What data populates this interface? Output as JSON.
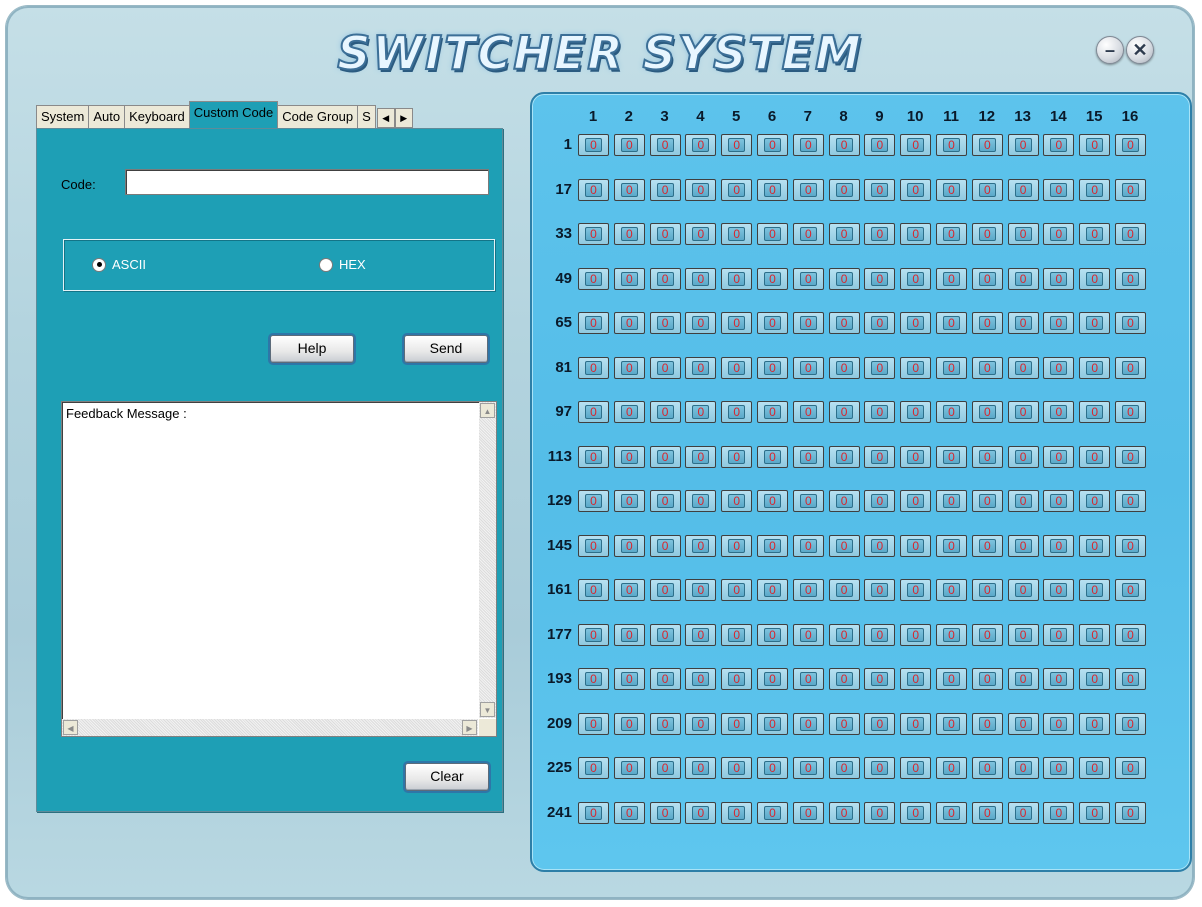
{
  "window": {
    "title": "SWITCHER SYSTEM",
    "minimize": "–",
    "close": "✕"
  },
  "tabs": [
    {
      "label": "System"
    },
    {
      "label": "Auto"
    },
    {
      "label": "Keyboard"
    },
    {
      "label": "Custom Code",
      "active": true
    },
    {
      "label": "Code Group"
    },
    {
      "label": "S"
    }
  ],
  "tab_scroll": {
    "left": "◀",
    "right": "▶"
  },
  "form": {
    "code_label": "Code:",
    "code_value": "",
    "mode_options": [
      {
        "label": "ASCII",
        "selected": true
      },
      {
        "label": "HEX",
        "selected": false
      }
    ],
    "help_label": "Help",
    "send_label": "Send",
    "feedback_text": "Feedback Message :",
    "clear_label": "Clear"
  },
  "grid": {
    "columns": [
      "1",
      "2",
      "3",
      "4",
      "5",
      "6",
      "7",
      "8",
      "9",
      "10",
      "11",
      "12",
      "13",
      "14",
      "15",
      "16"
    ],
    "rows": [
      "1",
      "17",
      "33",
      "49",
      "65",
      "81",
      "97",
      "113",
      "129",
      "145",
      "161",
      "177",
      "193",
      "209",
      "225",
      "241"
    ],
    "cell_value": "0"
  },
  "colors": {
    "panel": "#1e9fb5",
    "grid": "#5dc3ec",
    "cell_text": "#d8262e"
  }
}
